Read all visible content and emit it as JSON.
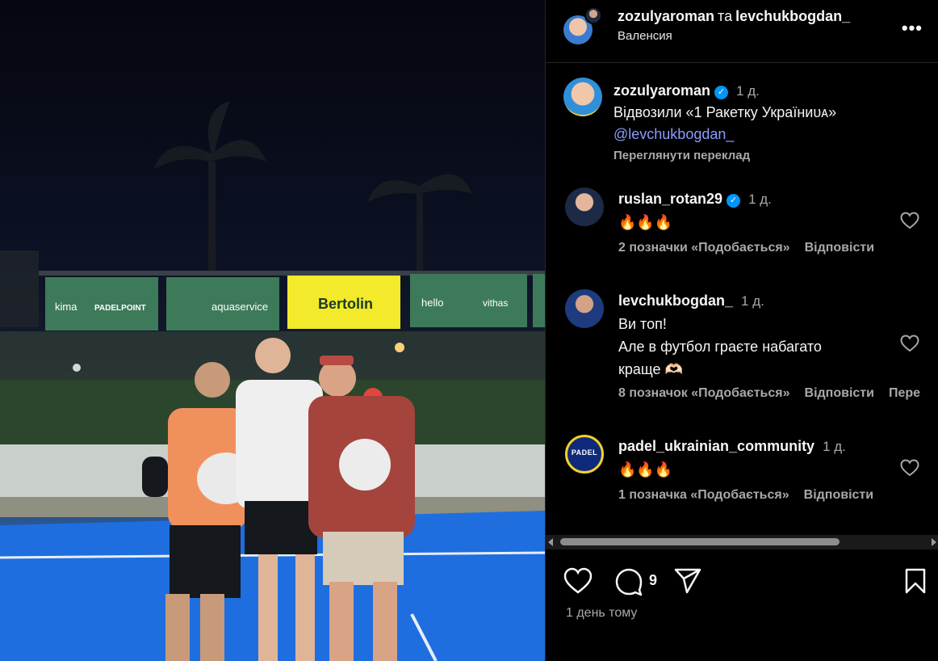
{
  "post": {
    "author": "zozulyaroman",
    "coauthor_join": "та",
    "coauthor": "levchukbogdan_",
    "location": "Валенсия",
    "caption": {
      "author": "zozulyaroman",
      "age": "1 д.",
      "text": "Відвозили «1 Ракетку Україниᴜᴀ»",
      "mention": "@levchukbogdan_",
      "translate_label": "Переглянути переклад"
    },
    "comment_count": "9",
    "timestamp": "1 день тому"
  },
  "photo_banners": [
    "kima",
    "PADELPOINT",
    "aquaservice",
    "Bertolin",
    "hello",
    "vithas"
  ],
  "comments": [
    {
      "username": "ruslan_rotan29",
      "verified": true,
      "age": "1 д.",
      "text": "🔥🔥🔥",
      "likes": "2 позначки «Подобається»",
      "reply": "Відповісти"
    },
    {
      "username": "levchukbogdan_",
      "verified": false,
      "age": "1 д.",
      "text_line1": "Ви топ!",
      "text_line2": "Але в футбол граєте набагато",
      "text_line3": "краще 🫶🏻",
      "likes": "8 позначок «Подобається»",
      "reply": "Відповісти",
      "extra": "Пере"
    },
    {
      "username": "padel_ukrainian_community",
      "verified": false,
      "age": "1 д.",
      "avatar_text": "PADEL",
      "text": "🔥🔥🔥",
      "likes": "1 позначка «Подобається»",
      "reply": "Відповісти"
    }
  ],
  "icons": [
    "more-icon",
    "verified-icon",
    "heart-icon",
    "comment-icon",
    "share-icon",
    "bookmark-icon"
  ],
  "colors": {
    "background": "#000000",
    "link": "#8a9cff",
    "verified": "#0095f6",
    "muted": "#a8a8a8"
  }
}
